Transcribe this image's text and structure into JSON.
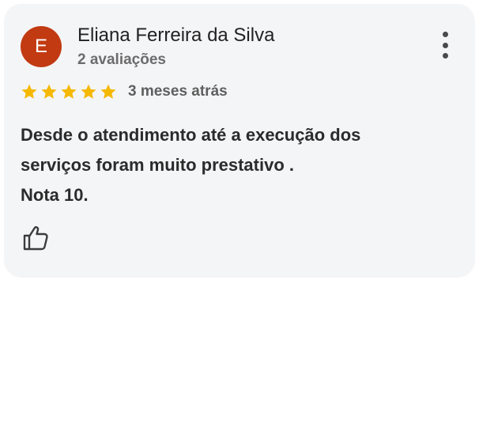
{
  "review": {
    "avatar_letter": "E",
    "avatar_color": "#c23a12",
    "reviewer_name": "Eliana Ferreira da Silva",
    "reviewer_meta": "2 avaliações",
    "rating": 5,
    "max_rating": 5,
    "star_color": "#f5b800",
    "time_ago": "3 meses atrás",
    "text_lines": [
      "Desde o atendimento até a execução dos",
      "serviços foram muito prestativo .",
      "Nota 10."
    ]
  },
  "icons": {
    "menu": "more-vert-icon",
    "like": "thumbs-up-icon",
    "star": "star-icon"
  }
}
